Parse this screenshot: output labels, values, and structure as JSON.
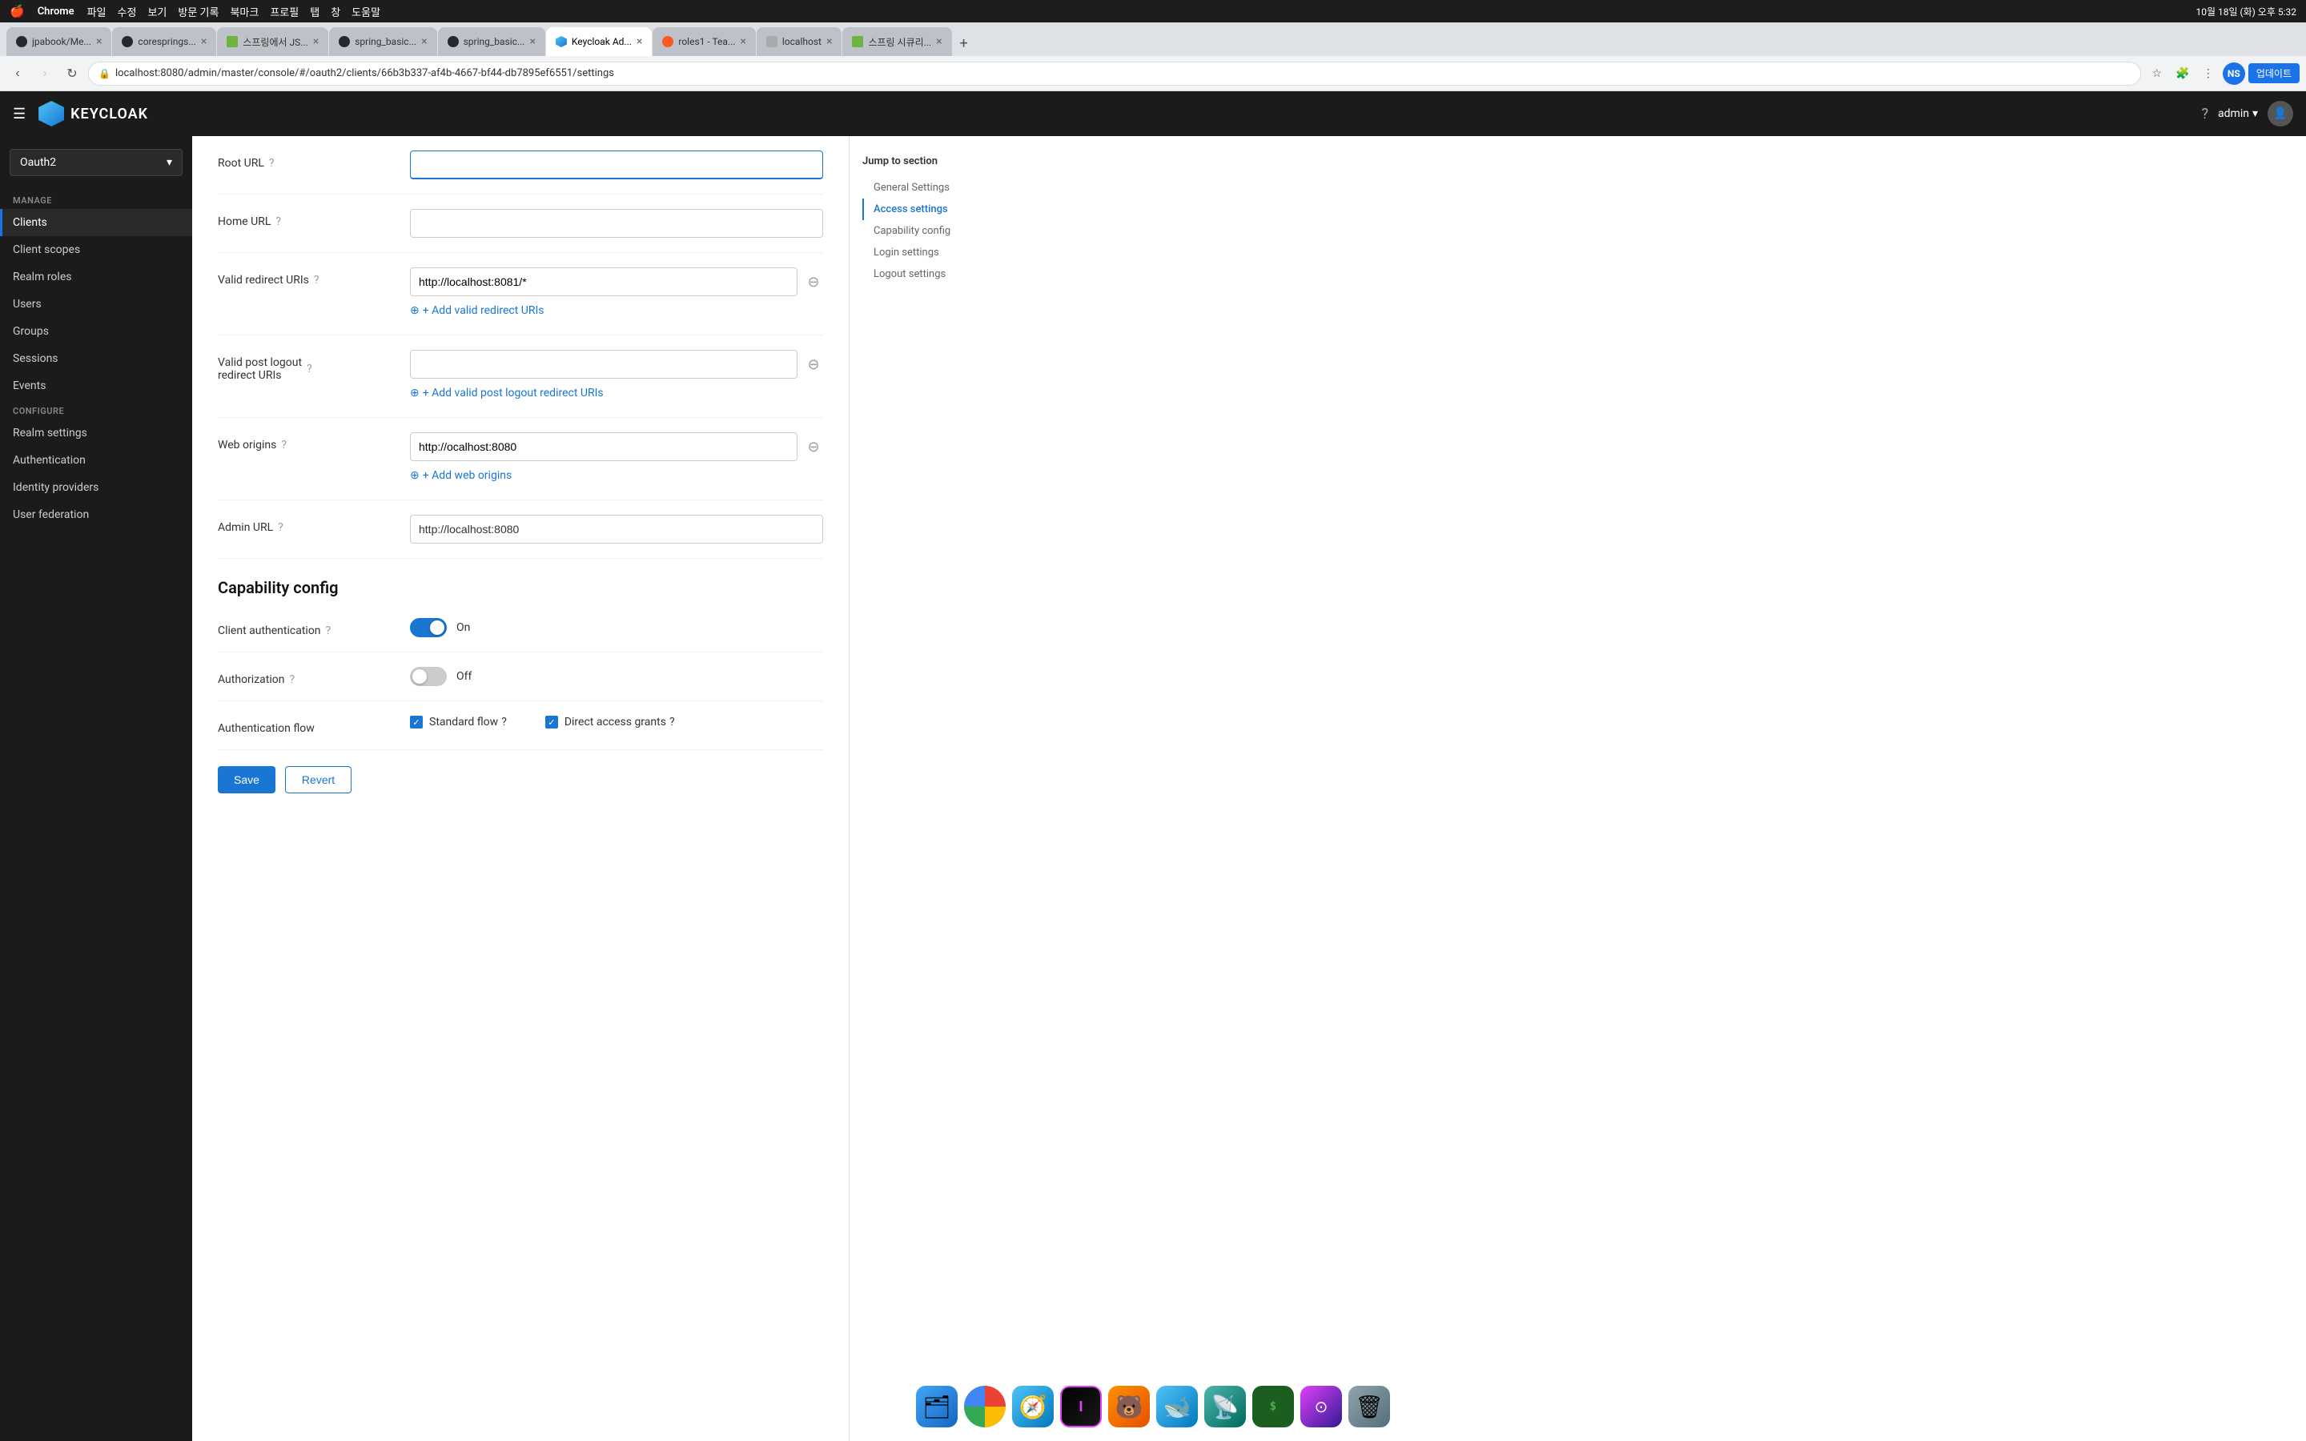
{
  "menubar": {
    "apple": "🍎",
    "app": "Chrome",
    "menus": [
      "파일",
      "수정",
      "보기",
      "방문 기록",
      "북마크",
      "프로필",
      "탭",
      "창",
      "도움말"
    ],
    "time": "10월 18일 (화) 오후 5:32"
  },
  "browser": {
    "tabs": [
      {
        "id": "tab1",
        "label": "jpabook/Me...",
        "favicon": "github",
        "active": false
      },
      {
        "id": "tab2",
        "label": "coresprings...",
        "favicon": "github",
        "active": false
      },
      {
        "id": "tab3",
        "label": "스프링에서 JS...",
        "favicon": "spring",
        "active": false
      },
      {
        "id": "tab4",
        "label": "spring_basic...",
        "favicon": "github",
        "active": false
      },
      {
        "id": "tab5",
        "label": "spring_basic...",
        "favicon": "github",
        "active": false
      },
      {
        "id": "tab6",
        "label": "Keycloak Ad...",
        "favicon": "kc",
        "active": true
      },
      {
        "id": "tab7",
        "label": "roles1 - Tea...",
        "favicon": "roles",
        "active": false
      },
      {
        "id": "tab8",
        "label": "localhost",
        "favicon": "local",
        "active": false
      },
      {
        "id": "tab9",
        "label": "스프링 시큐리...",
        "favicon": "spring",
        "active": false
      }
    ],
    "address": "localhost:8080/admin/master/console/#/oauth2/clients/66b3b337-af4b-4667-bf44-db7895ef6551/settings",
    "update_btn": "업데이트"
  },
  "keycloak": {
    "logo_text": "KEYCLOAK",
    "admin_label": "admin",
    "realm": "Oauth2"
  },
  "sidebar": {
    "manage_label": "Manage",
    "items_manage": [
      {
        "id": "clients",
        "label": "Clients",
        "active": true
      },
      {
        "id": "client-scopes",
        "label": "Client scopes",
        "active": false
      },
      {
        "id": "realm-roles",
        "label": "Realm roles",
        "active": false
      },
      {
        "id": "users",
        "label": "Users",
        "active": false
      },
      {
        "id": "groups",
        "label": "Groups",
        "active": false
      },
      {
        "id": "sessions",
        "label": "Sessions",
        "active": false
      },
      {
        "id": "events",
        "label": "Events",
        "active": false
      }
    ],
    "configure_label": "Configure",
    "items_configure": [
      {
        "id": "realm-settings",
        "label": "Realm settings",
        "active": false
      },
      {
        "id": "authentication",
        "label": "Authentication",
        "active": false
      },
      {
        "id": "identity-providers",
        "label": "Identity providers",
        "active": false
      },
      {
        "id": "user-federation",
        "label": "User federation",
        "active": false
      }
    ]
  },
  "form": {
    "root_url_label": "Root URL",
    "home_url_label": "Home URL",
    "valid_redirect_label": "Valid redirect URIs",
    "valid_redirect_value": "http://localhost:8081/*",
    "add_redirect_label": "+ Add valid redirect URIs",
    "valid_post_logout_label": "Valid post logout redirect URIs",
    "add_post_logout_label": "+ Add valid post logout redirect URIs",
    "web_origins_label": "Web origins",
    "web_origins_value": "http://ocalhost:8080",
    "add_web_origins_label": "+ Add web origins",
    "admin_url_label": "Admin URL",
    "admin_url_value": "http://localhost:8080",
    "capability_heading": "Capability config",
    "client_auth_label": "Client authentication",
    "client_auth_state": "On",
    "auth_label": "Authorization",
    "auth_state": "Off",
    "auth_flow_label": "Authentication flow",
    "standard_flow_label": "Standard flow",
    "direct_access_label": "Direct access grants",
    "save_btn": "Save",
    "revert_btn": "Revert"
  },
  "jump_section": {
    "title": "Jump to section",
    "links": [
      {
        "id": "general",
        "label": "General Settings",
        "active": false
      },
      {
        "id": "access",
        "label": "Access settings",
        "active": true
      },
      {
        "id": "capability",
        "label": "Capability config",
        "active": false
      },
      {
        "id": "login",
        "label": "Login settings",
        "active": false
      },
      {
        "id": "logout",
        "label": "Logout settings",
        "active": false
      }
    ]
  },
  "dock": {
    "apps": [
      {
        "id": "finder",
        "label": "Finder",
        "emoji": "🗂"
      },
      {
        "id": "chrome",
        "label": "Chrome",
        "emoji": "●"
      },
      {
        "id": "safari",
        "label": "Safari",
        "emoji": "🧭"
      },
      {
        "id": "intellij",
        "label": "IntelliJ IDEA",
        "emoji": "🖥"
      },
      {
        "id": "bear",
        "label": "Bear",
        "emoji": "🐻"
      },
      {
        "id": "docker",
        "label": "Docker",
        "emoji": "🐋"
      },
      {
        "id": "wireless",
        "label": "Wireless Diagnostics",
        "emoji": "📡"
      },
      {
        "id": "terminal",
        "label": "Terminal",
        "emoji": "$_"
      },
      {
        "id": "altair",
        "label": "Altair",
        "emoji": "⊙"
      },
      {
        "id": "trash",
        "label": "Trash",
        "emoji": "🗑"
      }
    ]
  }
}
